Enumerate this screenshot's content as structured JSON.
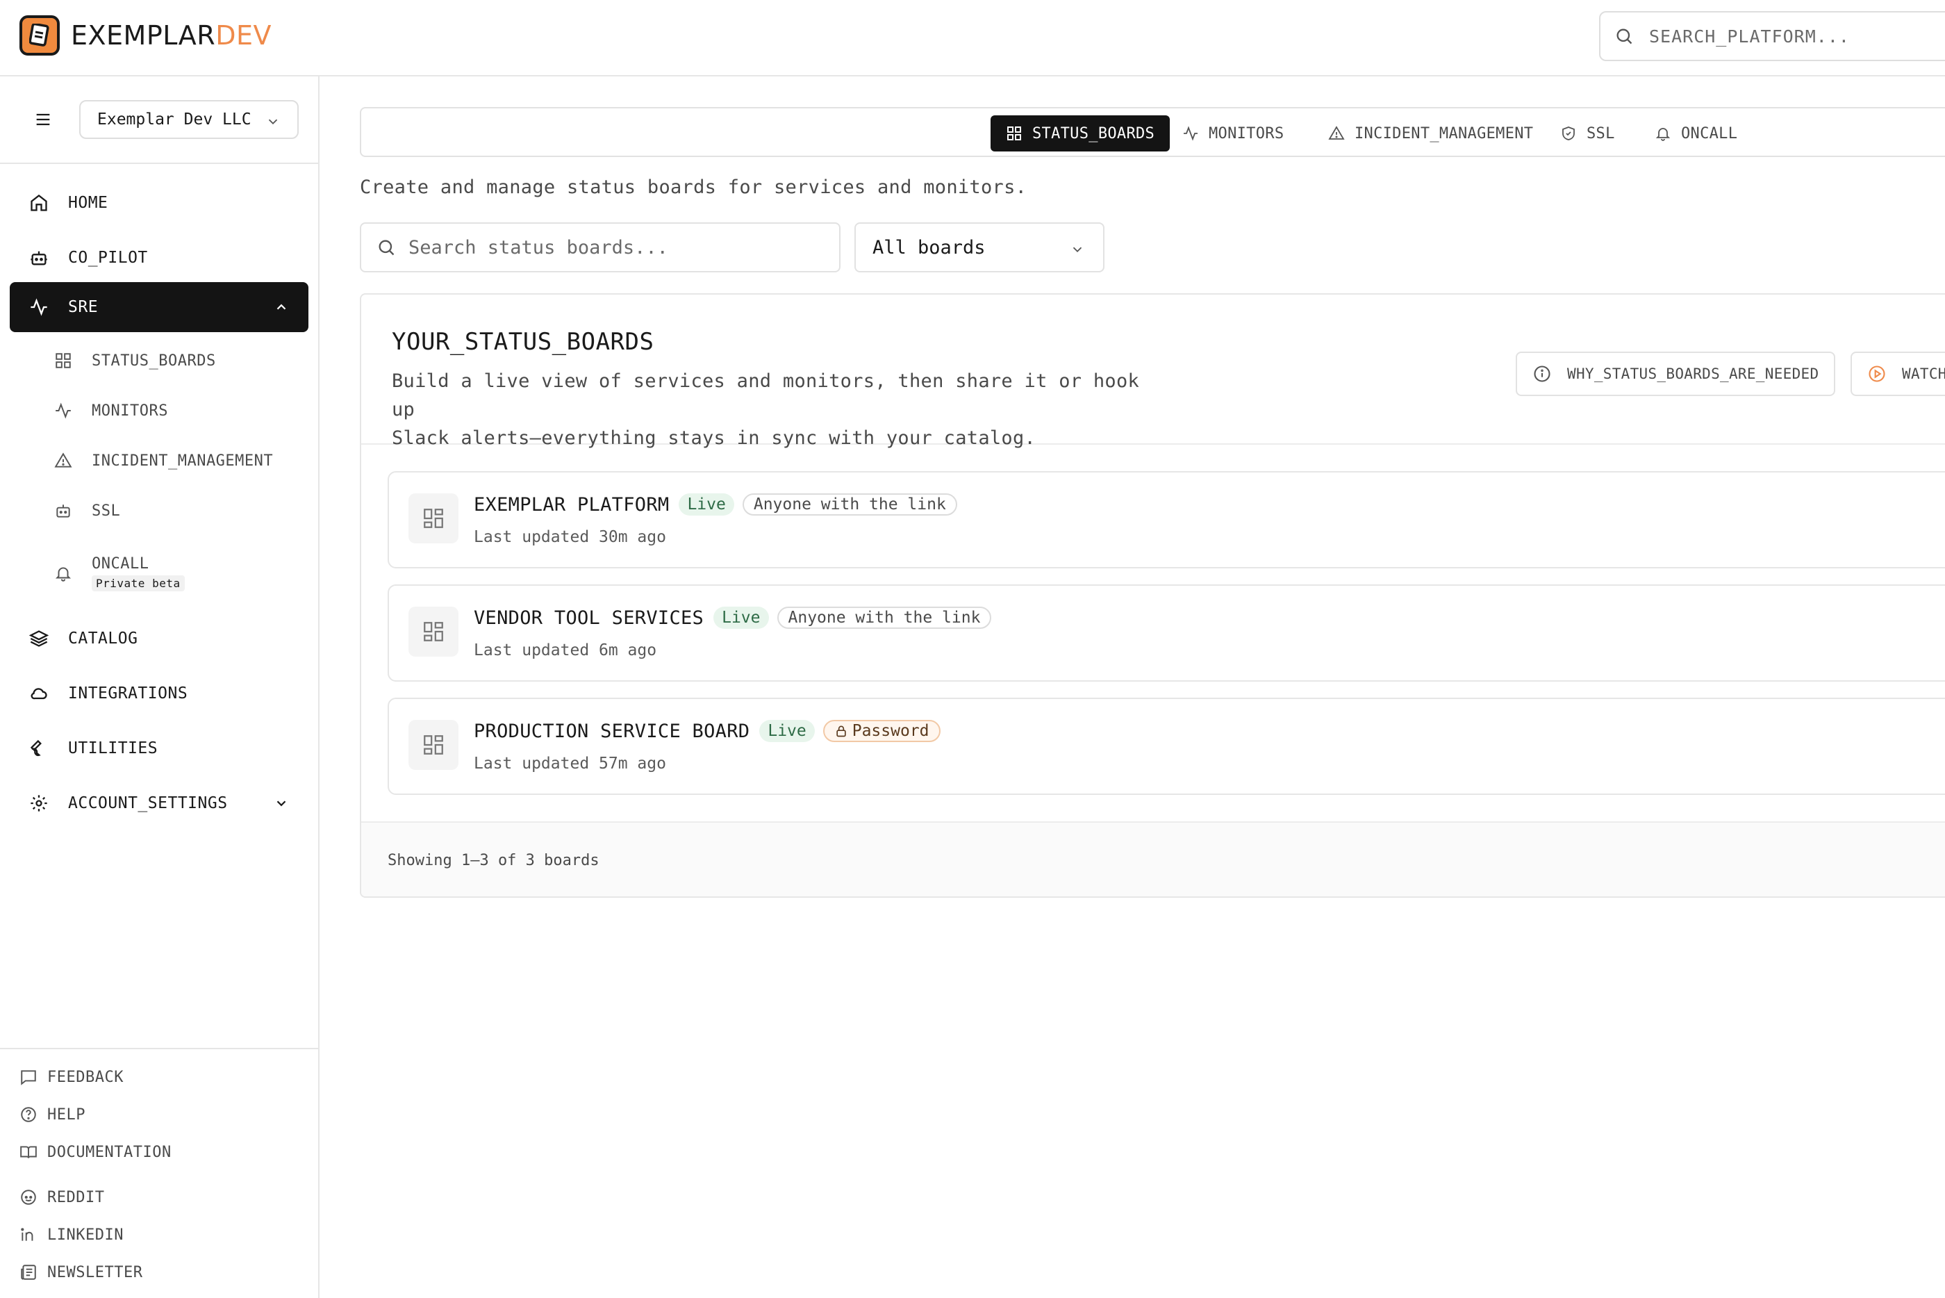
{
  "brand": {
    "name_part1": "EXEMPLAR",
    "name_part2": "DEV",
    "accent": "#ef8a4a"
  },
  "search": {
    "placeholder": "SEARCH_PLATFORM..."
  },
  "org": {
    "selected": "Exemplar Dev LLC"
  },
  "sidebar": {
    "items": [
      {
        "label": "HOME",
        "icon": "home-icon"
      },
      {
        "label": "CO_PILOT",
        "icon": "bot-icon"
      },
      {
        "label": "SRE",
        "icon": "activity-icon",
        "active": true,
        "expanded": true
      },
      {
        "label": "CATALOG",
        "icon": "layers-icon"
      },
      {
        "label": "INTEGRATIONS",
        "icon": "cloud-icon"
      },
      {
        "label": "UTILITIES",
        "icon": "wrench-icon"
      },
      {
        "label": "ACCOUNT_SETTINGS",
        "icon": "gear-icon"
      }
    ],
    "sre_sub": [
      {
        "label": "STATUS_BOARDS",
        "icon": "grid-icon"
      },
      {
        "label": "MONITORS",
        "icon": "activity-icon"
      },
      {
        "label": "INCIDENT_MANAGEMENT",
        "icon": "warning-icon"
      },
      {
        "label": "SSL",
        "icon": "bot-icon"
      },
      {
        "label": "ONCALL",
        "icon": "bell-icon",
        "badge": "Private beta"
      }
    ],
    "footer": [
      {
        "label": "FEEDBACK",
        "icon": "message-icon"
      },
      {
        "label": "HELP",
        "icon": "help-icon"
      },
      {
        "label": "DOCUMENTATION",
        "icon": "book-icon"
      },
      {
        "label": "REDDIT",
        "icon": "reddit-icon"
      },
      {
        "label": "LINKEDIN",
        "icon": "linkedin-icon"
      },
      {
        "label": "NEWSLETTER",
        "icon": "newspaper-icon"
      }
    ]
  },
  "tabs": [
    {
      "label": "STATUS_BOARDS",
      "icon": "grid-icon",
      "active": true
    },
    {
      "label": "MONITORS",
      "icon": "activity-icon"
    },
    {
      "label": "INCIDENT_MANAGEMENT",
      "icon": "warning-icon"
    },
    {
      "label": "SSL",
      "icon": "shield-icon"
    },
    {
      "label": "ONCALL",
      "icon": "bell-icon"
    }
  ],
  "main": {
    "subtitle": "Create and manage status boards for services and monitors.",
    "board_search_placeholder": "Search status boards...",
    "filter_selected": "All boards",
    "card": {
      "title": "YOUR_STATUS_BOARDS",
      "desc_line1": "Build a live view of services and monitors, then share it or hook up",
      "desc_line2": "Slack alerts—everything stays in sync with your catalog.",
      "btn_why": "WHY_STATUS_BOARDS_ARE_NEEDED",
      "btn_watch": "WATCH"
    },
    "boards": [
      {
        "name": "EXEMPLAR PLATFORM",
        "status": "Live",
        "access": "Anyone with the link",
        "updated": "Last updated 30m ago"
      },
      {
        "name": "VENDOR TOOL SERVICES",
        "status": "Live",
        "access": "Anyone with the link",
        "updated": "Last updated 6m ago"
      },
      {
        "name": "PRODUCTION SERVICE BOARD",
        "status": "Live",
        "access": "Password",
        "updated": "Last updated 57m ago"
      }
    ],
    "pagination": "Showing 1–3 of 3 boards"
  }
}
